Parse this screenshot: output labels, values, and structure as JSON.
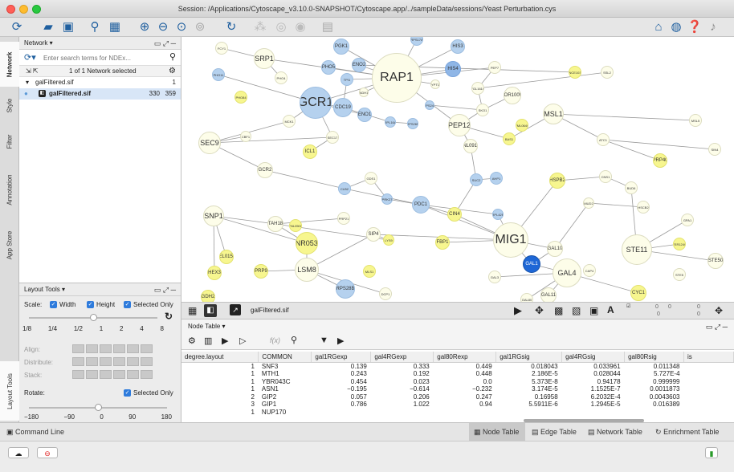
{
  "window": {
    "title": "Session: /Applications/Cytoscape_v3.10.0-SNAPSHOT/Cytoscape.app/../sampleData/sessions/Yeast Perturbation.cys"
  },
  "toolbar": {
    "icons": [
      "cytoscape-logo-icon",
      "open-folder-icon",
      "save-icon",
      "import-network-icon",
      "import-table-icon",
      "zoom-in-icon",
      "zoom-out-icon",
      "zoom-fit-icon",
      "zoom-selected-icon",
      "refresh-icon",
      "first-neighbors-icon",
      "hide-icon",
      "show-icon",
      "new-doc-icon",
      "home-icon",
      "globe-icon",
      "help-icon",
      "notification-icon"
    ],
    "search_placeholder": ""
  },
  "left_tabs": [
    "Network",
    "Style",
    "Filter",
    "Annotation",
    "App Store",
    "Layout Tools"
  ],
  "network_panel": {
    "title": "Network ▾",
    "search_placeholder": "Enter search terms for NDEx...",
    "selection_status": "1 of 1 Network selected",
    "collection_name": "galFiltered.sif",
    "collection_count": "1",
    "network_name": "galFiltered.sif",
    "nodes": "330",
    "edges": "359"
  },
  "layout_panel": {
    "title": "Layout Tools ▾",
    "scale_label": "Scale:",
    "width_label": "Width",
    "height_label": "Height",
    "selected_only_label": "Selected Only",
    "scale_ticks": [
      "1/8",
      "1/4",
      "1/2",
      "1",
      "2",
      "4",
      "8"
    ],
    "align_label": "Align:",
    "distribute_label": "Distribute:",
    "stack_label": "Stack:",
    "rotate_label": "Rotate:",
    "rotate_selected_label": "Selected Only",
    "rotate_ticks": [
      "−180",
      "−90",
      "0",
      "90",
      "180"
    ]
  },
  "view_bar": {
    "network_name": "galFiltered.sif",
    "readout_a": "0",
    "readout_b": "0",
    "readout_c": "0",
    "readout_d": "0",
    "readout_e": "0"
  },
  "table_panel": {
    "title": "Node Table ▾",
    "fx_label": "f(x)",
    "columns": [
      "degree.layout",
      "COMMON",
      "gal1RGexp",
      "gal4RGexp",
      "gal80Rexp",
      "gal1RGsig",
      "gal4RGsig",
      "gal80Rsig",
      "is"
    ],
    "rows": [
      [
        "1",
        "SNF3",
        "0.139",
        "0.333",
        "0.449",
        "0.018043",
        "0.033961",
        "0.011348"
      ],
      [
        "1",
        "MTH1",
        "0.243",
        "0.192",
        "0.448",
        "2.186E-5",
        "0.028044",
        "5.727E-4"
      ],
      [
        "1",
        "YBR043C",
        "0.454",
        "0.023",
        "0.0",
        "5.373E-8",
        "0.94178",
        "0.999999"
      ],
      [
        "1",
        "ASN1",
        "−0.195",
        "−0.614",
        "−0.232",
        "3.174E-5",
        "1.1525E-7",
        "0.0011873"
      ],
      [
        "2",
        "GIP2",
        "0.057",
        "0.206",
        "0.247",
        "0.16958",
        "6.2032E-4",
        "0.0043603"
      ],
      [
        "3",
        "GIP1",
        "0.786",
        "1.022",
        "0.94",
        "5.5911E-6",
        "1.2945E-5",
        "0.016389"
      ],
      [
        "1",
        "NUP170",
        "",
        "",
        "",
        "",
        "",
        ""
      ]
    ]
  },
  "bottom_tabs": {
    "command_line": "Command Line",
    "node_table": "Node Table",
    "edge_table": "Edge Table",
    "network_table": "Network Table",
    "enrichment_table": "Enrichment Table"
  },
  "graph": {
    "nodes": [
      {
        "label": "FCY1",
        "c": "nw"
      },
      {
        "label": "SRP1",
        "c": "nw"
      },
      {
        "label": "PGK1",
        "c": "nb"
      },
      {
        "label": "RPS17A",
        "c": "nb"
      },
      {
        "label": "HIS3",
        "c": "nb"
      },
      {
        "label": "RAP1",
        "c": "nw"
      },
      {
        "label": "PHO5",
        "c": "nb"
      },
      {
        "label": "ENO2",
        "c": "nb"
      },
      {
        "label": "HIS4",
        "c": "nm"
      },
      {
        "label": "PEP7",
        "c": "nw"
      },
      {
        "label": "NCE103",
        "c": "ny"
      },
      {
        "label": "SSL2",
        "c": "nw"
      },
      {
        "label": "PHO11",
        "c": "nb"
      },
      {
        "label": "PHO4",
        "c": "nw"
      },
      {
        "label": "TPI1",
        "c": "nb"
      },
      {
        "label": "YPT1",
        "c": "nw"
      },
      {
        "label": "YGL161C",
        "c": "nw"
      },
      {
        "label": "GCR1",
        "c": "nb"
      },
      {
        "label": "ADH1",
        "c": "nw"
      },
      {
        "label": "CDC19",
        "c": "nb"
      },
      {
        "label": "YOR100W",
        "c": "nw"
      },
      {
        "label": "PHO84",
        "c": "ny"
      },
      {
        "label": "RPS24A",
        "c": "nb"
      },
      {
        "label": "SKO1",
        "c": "nw"
      },
      {
        "label": "MSL1",
        "c": "nw"
      },
      {
        "label": "ENO1",
        "c": "nb"
      },
      {
        "label": "RPL16A",
        "c": "nb"
      },
      {
        "label": "RPS26B",
        "c": "nb"
      },
      {
        "label": "PEP12",
        "c": "nw"
      },
      {
        "label": "YML064C",
        "c": "ny"
      },
      {
        "label": "MSL5",
        "c": "nw"
      },
      {
        "label": "MCK1",
        "c": "nw"
      },
      {
        "label": "CBF1",
        "c": "nw"
      },
      {
        "label": "SEC17",
        "c": "nw"
      },
      {
        "label": "BAS1",
        "c": "ny"
      },
      {
        "label": "ATC1",
        "c": "nw"
      },
      {
        "label": "SEC9",
        "c": "nw"
      },
      {
        "label": "ICL1",
        "c": "ny"
      },
      {
        "label": "YNL091W",
        "c": "nw"
      },
      {
        "label": "SIN4",
        "c": "nw"
      },
      {
        "label": "PRP40",
        "c": "ny"
      },
      {
        "label": "GCR2",
        "c": "nw"
      },
      {
        "label": "GDS1",
        "c": "nw"
      },
      {
        "label": "SUC2",
        "c": "nb"
      },
      {
        "label": "AHP1",
        "c": "nb"
      },
      {
        "label": "HSPB2",
        "c": "ny"
      },
      {
        "label": "CNS1",
        "c": "nw"
      },
      {
        "label": "BUD6",
        "c": "nw"
      },
      {
        "label": "CLB2",
        "c": "nb"
      },
      {
        "label": "PRK27",
        "c": "nb"
      },
      {
        "label": "MUD2",
        "c": "nw"
      },
      {
        "label": "PDC1",
        "c": "nb"
      },
      {
        "label": "HSCB2",
        "c": "nw"
      },
      {
        "label": "SNP1",
        "c": "nw"
      },
      {
        "label": "TAH18",
        "c": "nw"
      },
      {
        "label": "YNL050C",
        "c": "ny"
      },
      {
        "label": "PRP21",
        "c": "nw"
      },
      {
        "label": "CIN4",
        "c": "ny"
      },
      {
        "label": "RPL42B",
        "c": "nb"
      },
      {
        "label": "GPA1",
        "c": "nw"
      },
      {
        "label": "SIP4",
        "c": "nw"
      },
      {
        "label": "MIG1",
        "c": "nw"
      },
      {
        "label": "YNR053C",
        "c": "ny"
      },
      {
        "label": "LYS9",
        "c": "ny"
      },
      {
        "label": "FBP1",
        "c": "ny"
      },
      {
        "label": "YER124C",
        "c": "ny"
      },
      {
        "label": "GAL10",
        "c": "nw"
      },
      {
        "label": "STE11",
        "c": "nw"
      },
      {
        "label": "YEL015W",
        "c": "ny"
      },
      {
        "label": "HEX3",
        "c": "ny"
      },
      {
        "label": "PRP9",
        "c": "ny"
      },
      {
        "label": "LSM8",
        "c": "nw"
      },
      {
        "label": "MLS1",
        "c": "ny"
      },
      {
        "label": "GAL1",
        "c": "nd"
      },
      {
        "label": "GAL4",
        "c": "nw"
      },
      {
        "label": "CAP4",
        "c": "nw"
      },
      {
        "label": "STE5",
        "c": "nw"
      },
      {
        "label": "STE50",
        "c": "nw"
      },
      {
        "label": "GDH2",
        "c": "ny"
      },
      {
        "label": "RPS28B",
        "c": "nb"
      },
      {
        "label": "DCP1",
        "c": "nw"
      },
      {
        "label": "GAL3",
        "c": "nw"
      },
      {
        "label": "CYC1",
        "c": "ny"
      },
      {
        "label": "GAL11",
        "c": "nw"
      },
      {
        "label": "GAL80",
        "c": "nw"
      }
    ],
    "edges": [
      [
        1,
        5
      ],
      [
        5,
        6
      ],
      [
        5,
        7
      ],
      [
        5,
        2
      ],
      [
        5,
        14
      ],
      [
        5,
        15
      ],
      [
        5,
        17
      ],
      [
        5,
        18
      ],
      [
        5,
        28
      ],
      [
        5,
        9
      ],
      [
        5,
        8
      ],
      [
        5,
        4
      ],
      [
        5,
        3
      ],
      [
        17,
        19
      ],
      [
        17,
        25
      ],
      [
        17,
        31
      ],
      [
        17,
        12
      ],
      [
        1,
        13
      ],
      [
        1,
        0
      ],
      [
        28,
        23
      ],
      [
        28,
        38
      ],
      [
        23,
        16
      ],
      [
        23,
        20
      ],
      [
        16,
        11
      ],
      [
        16,
        9
      ],
      [
        28,
        34
      ],
      [
        34,
        24
      ],
      [
        24,
        30
      ],
      [
        24,
        35
      ],
      [
        35,
        39
      ],
      [
        35,
        40
      ],
      [
        36,
        32
      ],
      [
        36,
        31
      ],
      [
        36,
        41
      ],
      [
        41,
        48
      ],
      [
        48,
        42
      ],
      [
        48,
        51
      ],
      [
        51,
        57
      ],
      [
        57,
        61
      ],
      [
        61,
        66
      ],
      [
        61,
        73
      ],
      [
        61,
        64
      ],
      [
        61,
        60
      ],
      [
        61,
        45
      ],
      [
        45,
        46
      ],
      [
        46,
        47
      ],
      [
        47,
        67
      ],
      [
        67,
        59
      ],
      [
        67,
        65
      ],
      [
        67,
        77
      ],
      [
        73,
        74
      ],
      [
        74,
        83
      ],
      [
        74,
        81
      ],
      [
        74,
        84
      ],
      [
        74,
        82
      ],
      [
        74,
        85
      ],
      [
        73,
        66
      ],
      [
        66,
        50
      ],
      [
        50,
        52
      ],
      [
        53,
        54
      ],
      [
        54,
        62
      ],
      [
        54,
        56
      ],
      [
        53,
        69
      ],
      [
        53,
        68
      ],
      [
        71,
        62
      ],
      [
        71,
        70
      ],
      [
        71,
        79
      ],
      [
        71,
        80
      ],
      [
        60,
        63
      ],
      [
        60,
        71
      ],
      [
        63,
        54
      ],
      [
        62,
        53
      ],
      [
        42,
        49
      ],
      [
        49,
        51
      ],
      [
        51,
        58
      ],
      [
        58,
        61
      ],
      [
        43,
        44
      ],
      [
        43,
        57
      ],
      [
        61,
        51
      ],
      [
        33,
        36
      ],
      [
        33,
        17
      ],
      [
        33,
        37
      ],
      [
        38,
        43
      ],
      [
        19,
        14
      ],
      [
        19,
        26
      ],
      [
        26,
        27
      ],
      [
        22,
        23
      ],
      [
        7,
        10
      ]
    ]
  }
}
